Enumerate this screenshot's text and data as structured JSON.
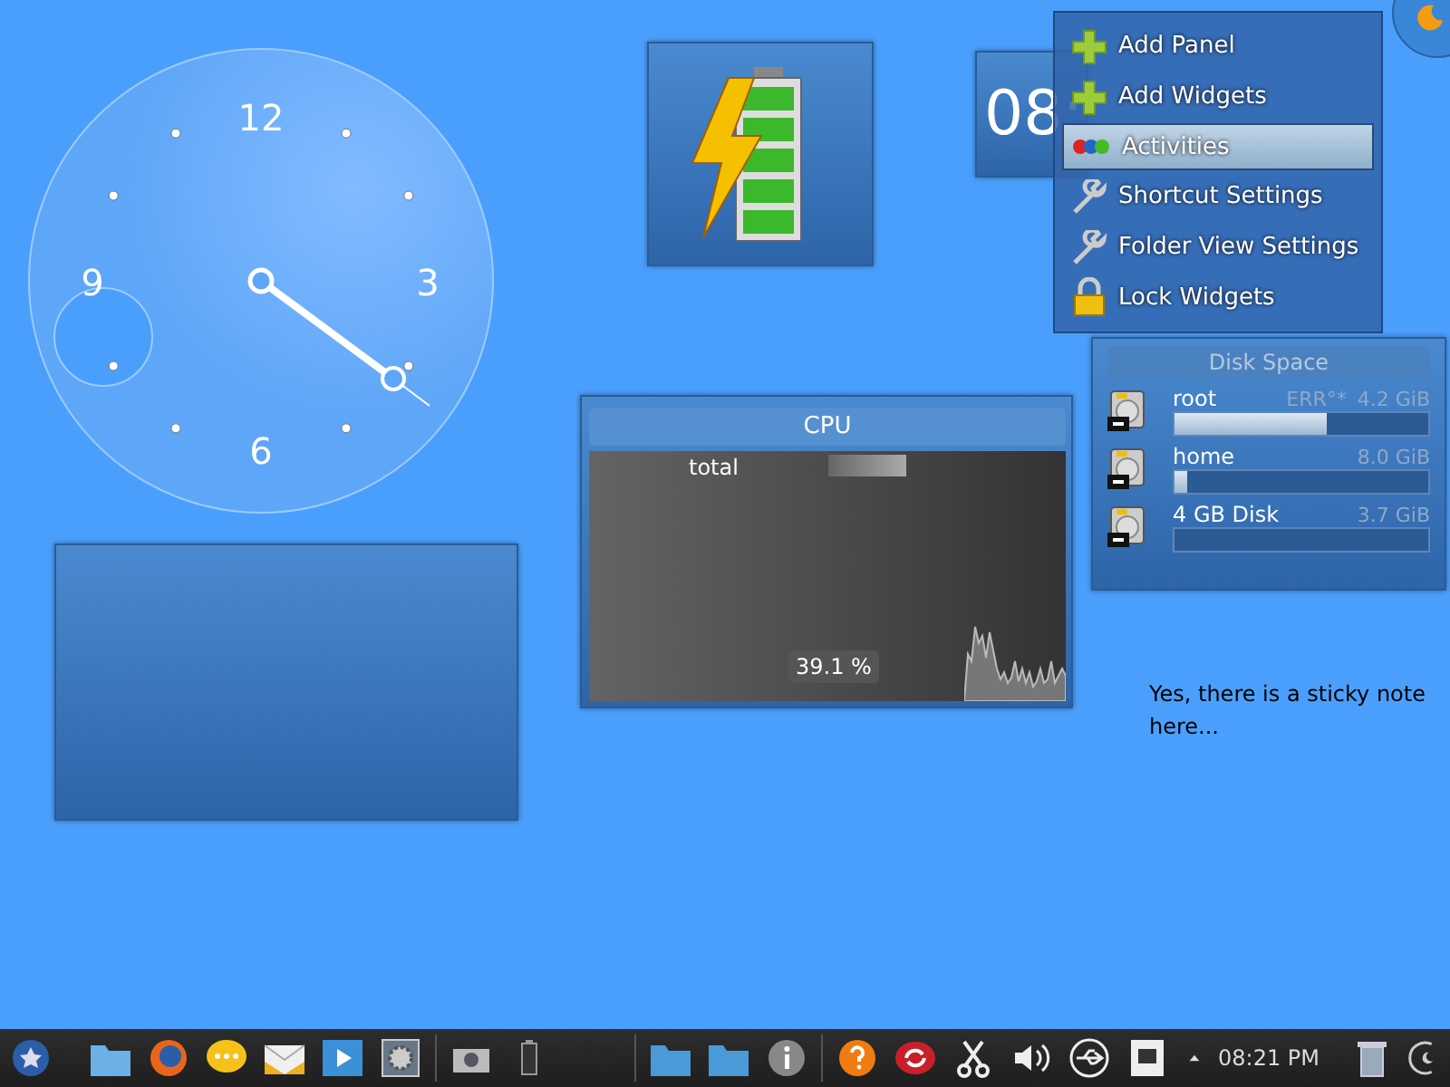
{
  "analog_clock": {
    "numerals": [
      "12",
      "3",
      "6",
      "9"
    ]
  },
  "digital_clock": {
    "time": "08:"
  },
  "desktop_menu": {
    "items": [
      {
        "label": "Add Panel",
        "kind": "plus",
        "selected": false
      },
      {
        "label": "Add Widgets",
        "kind": "plus",
        "selected": false
      },
      {
        "label": "Activities",
        "kind": "activities",
        "selected": true
      },
      {
        "label": "Shortcut Settings",
        "kind": "wrench",
        "selected": false
      },
      {
        "label": "Folder View Settings",
        "kind": "wrench",
        "selected": false
      },
      {
        "label": "Lock Widgets",
        "kind": "lock",
        "selected": false
      }
    ]
  },
  "cpu_monitor": {
    "title": "CPU",
    "label": "total",
    "reading": "39.1 %"
  },
  "disk_space": {
    "title": "Disk Space",
    "disks": [
      {
        "name": "root",
        "status": "ERR°*",
        "size": "4.2 GiB",
        "level": 0.6
      },
      {
        "name": "home",
        "size": "8.0 GiB",
        "level": 0.05
      },
      {
        "name": "4 GB Disk",
        "size": "3.7 GiB",
        "level": 0
      }
    ]
  },
  "sticky_note": {
    "text": "Yes, there is a sticky note here..."
  },
  "taskbar": {
    "clock": "08:21 PM"
  }
}
